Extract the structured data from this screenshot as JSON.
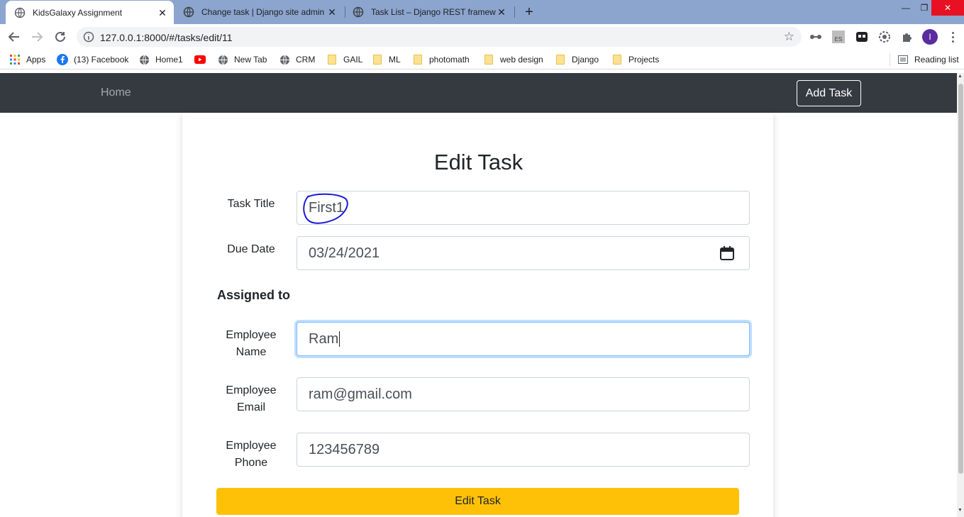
{
  "browser": {
    "tabs": [
      {
        "title": "KidsGalaxy Assignment",
        "active": true
      },
      {
        "title": "Change task | Django site admin",
        "active": false
      },
      {
        "title": "Task List – Django REST framewo",
        "active": false
      }
    ],
    "new_tab_symbol": "+",
    "url": "127.0.0.1:8000/#/tasks/edit/11",
    "profile_initial": "I",
    "extension_badge": "ES",
    "bookmarks": [
      {
        "label": "Apps",
        "icon": "apps-grid-icon"
      },
      {
        "label": "(13) Facebook",
        "icon": "facebook-icon"
      },
      {
        "label": "Home1",
        "icon": "globe-icon"
      },
      {
        "label": "",
        "icon": "youtube-icon"
      },
      {
        "label": "New Tab",
        "icon": "globe-icon"
      },
      {
        "label": "CRM",
        "icon": "globe-icon"
      },
      {
        "label": "GAIL",
        "icon": "folder-icon"
      },
      {
        "label": "ML",
        "icon": "folder-icon"
      },
      {
        "label": "photomath",
        "icon": "folder-icon"
      },
      {
        "label": "web design",
        "icon": "folder-icon"
      },
      {
        "label": "Django",
        "icon": "folder-icon"
      },
      {
        "label": "Projects",
        "icon": "folder-icon"
      }
    ],
    "reading_list": "Reading list"
  },
  "app": {
    "nav": {
      "home": "Home",
      "add_task": "Add Task"
    },
    "heading": "Edit Task",
    "form": {
      "task_title": {
        "label": "Task Title",
        "value": "First1"
      },
      "due_date": {
        "label": "Due Date",
        "value": "03/24/2021"
      },
      "assigned_to": "Assigned to",
      "employee_name": {
        "label_line1": "Employee",
        "label_line2": "Name",
        "value": "Ram"
      },
      "employee_email": {
        "label_line1": "Employee",
        "label_line2": "Email",
        "value": "ram@gmail.com"
      },
      "employee_phone": {
        "label_line1": "Employee",
        "label_line2": "Phone",
        "value": "123456789"
      },
      "submit": "Edit Task"
    }
  },
  "colors": {
    "navbar": "#343a40",
    "submit_button": "#ffc107",
    "annotation_circle": "#1a1ad6",
    "tabstrip": "#8ca5ce"
  }
}
